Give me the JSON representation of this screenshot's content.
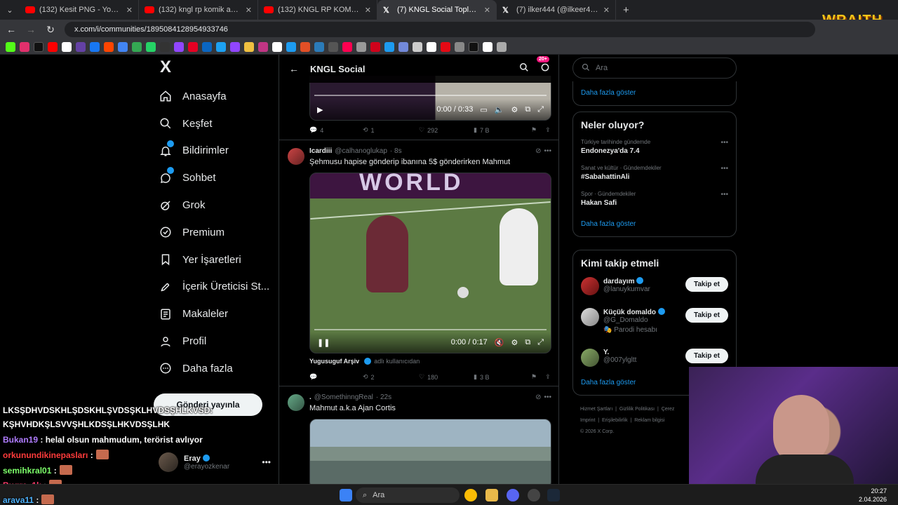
{
  "browser": {
    "tabs": [
      {
        "title": "(132) Kesit PNG - YouTube",
        "type": "youtube"
      },
      {
        "title": "(132) kngl rp komik anlar - YouTube",
        "type": "youtube"
      },
      {
        "title": "(132) KNGL RP KOMİK ANLAR",
        "type": "youtube"
      },
      {
        "title": "(7) KNGL Social Topluluk / X",
        "type": "x",
        "active": true
      },
      {
        "title": "(7) ilker444 (@ilkeer444) / X",
        "type": "x"
      }
    ],
    "url": "x.com/i/communities/1895084128954933746",
    "overlay_brand": "WRAITH"
  },
  "leftnav": {
    "logo": "X",
    "items": [
      {
        "label": "Anasayfa",
        "icon": "home-icon"
      },
      {
        "label": "Keşfet",
        "icon": "search-icon"
      },
      {
        "label": "Bildirimler",
        "icon": "bell-icon",
        "badge": true
      },
      {
        "label": "Sohbet",
        "icon": "chat-icon",
        "badge": true
      },
      {
        "label": "Grok",
        "icon": "grok-icon"
      },
      {
        "label": "Premium",
        "icon": "premium-icon"
      },
      {
        "label": "Yer İşaretleri",
        "icon": "bookmark-icon"
      },
      {
        "label": "İçerik Üreticisi St...",
        "icon": "rocket-icon"
      },
      {
        "label": "Makaleler",
        "icon": "article-icon"
      },
      {
        "label": "Profil",
        "icon": "person-icon"
      },
      {
        "label": "Daha fazla",
        "icon": "more-icon"
      }
    ],
    "post_button": "Gönderi yayınla",
    "account": {
      "name": "Eray",
      "handle": "@erayozkenar"
    }
  },
  "main": {
    "title": "KNGL Social",
    "age_badge": "20+",
    "post0": {
      "video_time": "0:00 / 0:33",
      "replies": "4",
      "reposts": "1",
      "likes": "292",
      "views": "7 B"
    },
    "post1": {
      "name": "Icardiii",
      "handle": "@calhanoglukap",
      "time": "· 8s",
      "text": "Şehmusu hapise gönderip ibanına 5$ gönderirken Mahmut",
      "video_banner": "WORLD",
      "video_time": "0:00 / 0:17",
      "source_name": "Yugusuguf Arşiv",
      "source_suffix": "adlı kullanıcıdan",
      "replies": "",
      "reposts": "2",
      "likes": "180",
      "views": "3 B"
    },
    "post2": {
      "name": ".",
      "handle": "@SomethinngReal",
      "time": "· 22s",
      "text": "Mahmut a.k.a Ajan Cortis"
    }
  },
  "right": {
    "search_placeholder": "Ara",
    "top_more": "Daha fazla göster",
    "trends_title": "Neler oluyor?",
    "trends": [
      {
        "sub": "Türkiye tarihinde gündemde",
        "name": "Endonezya'da 7.4"
      },
      {
        "sub": "Sanat ve kültür · Gündemdekiler",
        "name": "#SabahattinAli"
      },
      {
        "sub": "Spor · Gündemdekiler",
        "name": "Hakan Safi"
      }
    ],
    "trends_more": "Daha fazla göster",
    "who_title": "Kimi takip etmeli",
    "who": [
      {
        "name": "dardayım",
        "handle": "@lanuykumvar",
        "extra": ""
      },
      {
        "name": "Küçük domaldo",
        "handle": "@G_Domaldo",
        "extra": "Parodi hesabı"
      },
      {
        "name": "Y.",
        "handle": "@007ylgltt",
        "extra": ""
      }
    ],
    "follow_label": "Takip et",
    "who_more": "Daha fazla göster",
    "footer": [
      "Hizmet Şartları",
      "Gizlilik Politikası",
      "Çerez",
      "Imprint",
      "Erişilebilirlik",
      "Reklam bilgisi",
      "© 2026 X Corp."
    ]
  },
  "chat": [
    {
      "user": "",
      "msg": "LKSŞDHVDSKHLŞDSKHLŞVDSŞKLHVDSŞHLKVSD:",
      "color": "#ffffff"
    },
    {
      "user": "",
      "msg": "KŞHVHDKŞLSVVŞHLKDSŞLHKVDSŞLHK",
      "color": "#ffffff"
    },
    {
      "user": "Bukan19",
      "msg": ": helal olsun mahmudum, terörist avlıyor",
      "color": "#b07cff"
    },
    {
      "user": "orkunundikinepasları",
      "msg": ":",
      "color": "#ff3b3b"
    },
    {
      "user": "semihkral01",
      "msg": ":",
      "color": "#7dff6a"
    },
    {
      "user": "Bugra_1k",
      "msg": ":",
      "color": "#ff3b6b"
    },
    {
      "user": "arava11",
      "msg": ":",
      "color": "#4fb4ff"
    }
  ],
  "taskbar": {
    "search": "Ara",
    "time": "20:27",
    "date": "2.04.2026"
  }
}
